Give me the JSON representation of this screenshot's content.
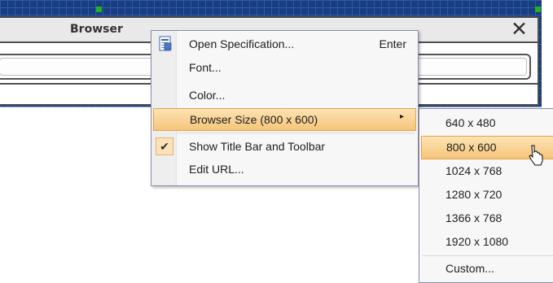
{
  "window": {
    "title": "Browser",
    "close_glyph": "✕"
  },
  "context_menu": {
    "items": [
      {
        "label": "Open Specification...",
        "shortcut": "Enter",
        "icon": "open-spec-icon"
      },
      {
        "label": "Font..."
      },
      {
        "label": "Color..."
      },
      {
        "label": "Browser Size (800 x 600)",
        "submenu_arrow": "▸",
        "highlighted": true
      },
      {
        "label": "Show Title Bar and Toolbar",
        "checked": true,
        "check_glyph": "✔"
      },
      {
        "label": "Edit URL..."
      }
    ]
  },
  "size_submenu": {
    "items": [
      {
        "label": "640 x 480"
      },
      {
        "label": "800 x 600",
        "highlighted": true
      },
      {
        "label": "1024 x 768"
      },
      {
        "label": "1280 x 720"
      },
      {
        "label": "1366 x 768"
      },
      {
        "label": "1920 x 1080"
      },
      {
        "label": "Custom..."
      }
    ]
  },
  "colors": {
    "canvas": "#1a3d80",
    "highlight": "#f6c57a",
    "handle": "#1fb41f"
  }
}
